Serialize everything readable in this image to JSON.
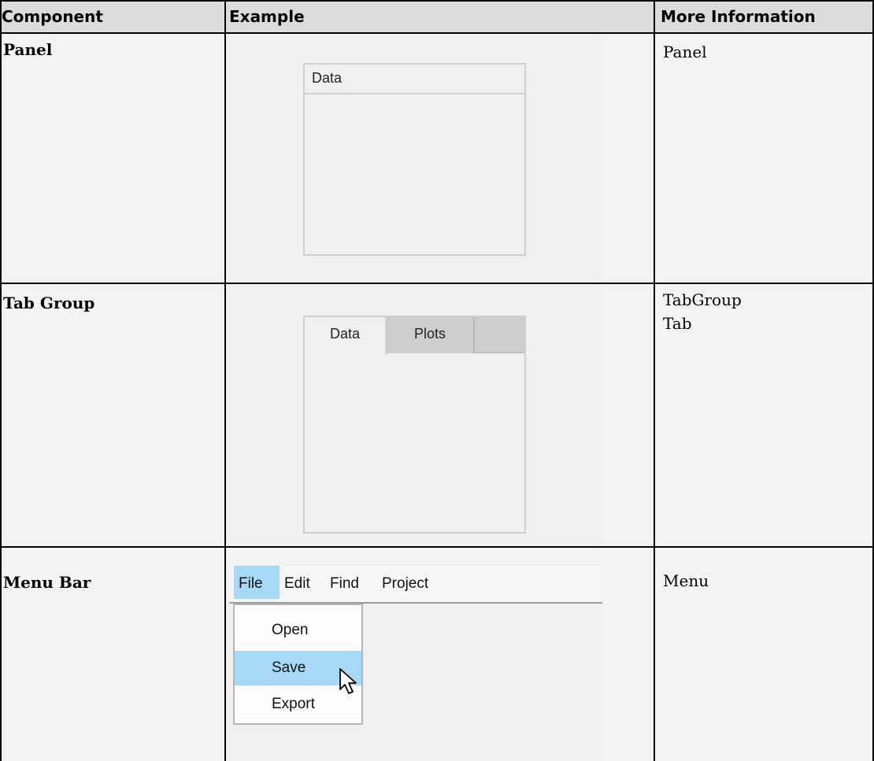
{
  "header": {
    "component": "Component",
    "example": "Example",
    "more_info": "More Information"
  },
  "rows": [
    {
      "component": "Panel",
      "example": {
        "panel_title": "Data"
      },
      "more_info": [
        "Panel"
      ]
    },
    {
      "component": "Tab Group",
      "example": {
        "tabs": [
          "Data",
          "Plots"
        ]
      },
      "more_info": [
        "TabGroup",
        "Tab"
      ]
    },
    {
      "component": "Menu Bar",
      "example": {
        "menus": [
          "File",
          "Edit",
          "Find",
          "Project"
        ],
        "active_menu": "File",
        "dropdown_items": [
          "Open",
          "Save",
          "Export"
        ],
        "hovered_item": "Save"
      },
      "more_info": [
        "Menu"
      ]
    }
  ],
  "colors": {
    "header_bg": "#dcdcdc",
    "highlight": "#a8d8f8",
    "grid_line": "#000000"
  },
  "icons": {
    "cursor": "arrow-cursor-icon"
  }
}
